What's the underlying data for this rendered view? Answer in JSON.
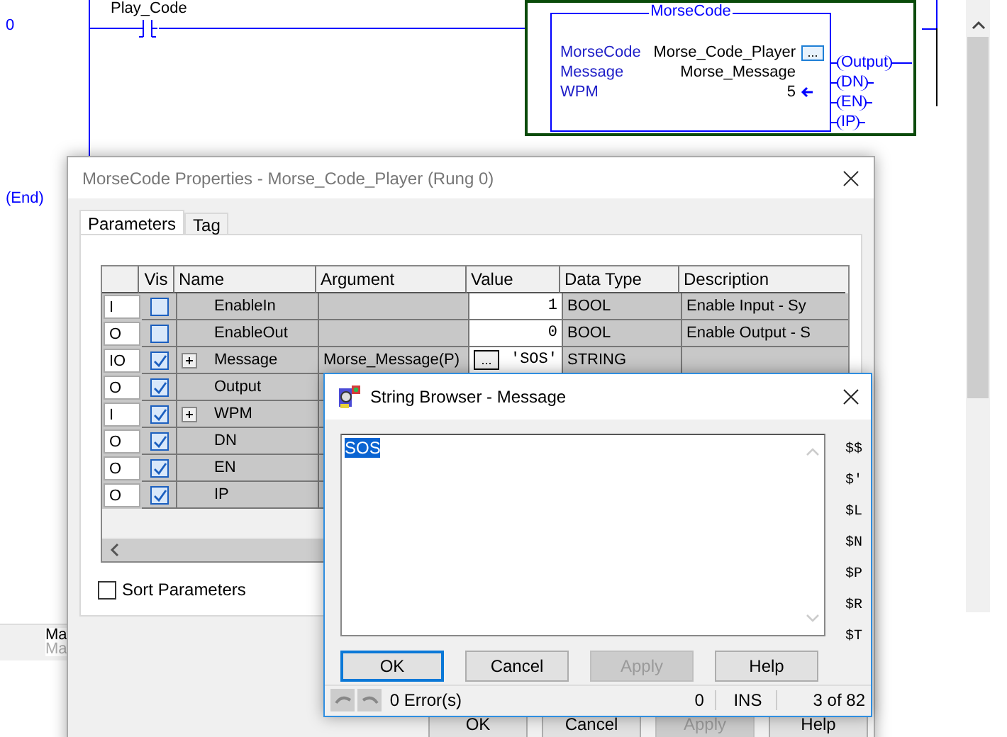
{
  "ladder": {
    "rungs": [
      {
        "number": "0"
      },
      {
        "number": "(End)"
      }
    ],
    "contact": {
      "tag": "Play_Code"
    },
    "block": {
      "title": "MorseCode",
      "params": [
        {
          "name": "MorseCode",
          "value": "Morse_Code_Player",
          "kind": "browse",
          "browse": "..."
        },
        {
          "name": "Message",
          "value": "Morse_Message",
          "kind": "plain"
        },
        {
          "name": "WPM",
          "value": "5",
          "kind": "input"
        }
      ],
      "outputs": [
        "Output",
        "DN",
        "EN",
        "IP"
      ]
    },
    "bottom_tabs": [
      "Ma",
      "Ma"
    ]
  },
  "properties": {
    "title": "MorseCode Properties - Morse_Code_Player (Rung 0)",
    "tabs": [
      {
        "label": "Parameters",
        "selected": true
      },
      {
        "label": "Tag",
        "selected": false
      }
    ],
    "columns": [
      "Vis",
      "Name",
      "Argument",
      "Value",
      "Data Type",
      "Description"
    ],
    "rows": [
      {
        "usage": "I",
        "vis": false,
        "expandable": false,
        "name": "EnableIn",
        "argument": "",
        "value": "1",
        "data_type": "BOOL",
        "description": "Enable Input - Sy"
      },
      {
        "usage": "O",
        "vis": false,
        "expandable": false,
        "name": "EnableOut",
        "argument": "",
        "value": "0",
        "data_type": "BOOL",
        "description": "Enable Output - S"
      },
      {
        "usage": "IO",
        "vis": true,
        "expandable": true,
        "name": "Message",
        "argument": "Morse_Message(P)",
        "value": "'SOS'",
        "browse": "...",
        "data_type": "STRING",
        "description": ""
      },
      {
        "usage": "O",
        "vis": true,
        "expandable": false,
        "name": "Output"
      },
      {
        "usage": "I",
        "vis": true,
        "expandable": true,
        "name": "WPM"
      },
      {
        "usage": "O",
        "vis": true,
        "expandable": false,
        "name": "DN"
      },
      {
        "usage": "O",
        "vis": true,
        "expandable": false,
        "name": "EN"
      },
      {
        "usage": "O",
        "vis": true,
        "expandable": false,
        "name": "IP"
      }
    ],
    "sort_parameters": {
      "label": "Sort Parameters",
      "checked": false
    },
    "buttons": [
      {
        "label": "OK",
        "disabled": false
      },
      {
        "label": "Cancel",
        "disabled": false
      },
      {
        "label": "Apply",
        "disabled": true
      },
      {
        "label": "Help",
        "disabled": false
      }
    ]
  },
  "string_browser": {
    "title": "String Browser - Message",
    "text": "SOS",
    "codes": [
      "$$",
      "$'",
      "$L",
      "$N",
      "$P",
      "$R",
      "$T"
    ],
    "buttons": [
      {
        "label": "OK",
        "disabled": false,
        "default": true
      },
      {
        "label": "Cancel",
        "disabled": false,
        "default": false
      },
      {
        "label": "Apply",
        "disabled": true,
        "default": false
      },
      {
        "label": "Help",
        "disabled": false,
        "default": false
      }
    ],
    "status": {
      "errors": "0 Error(s)",
      "count": "0",
      "mode": "INS",
      "position": "3 of 82"
    }
  }
}
